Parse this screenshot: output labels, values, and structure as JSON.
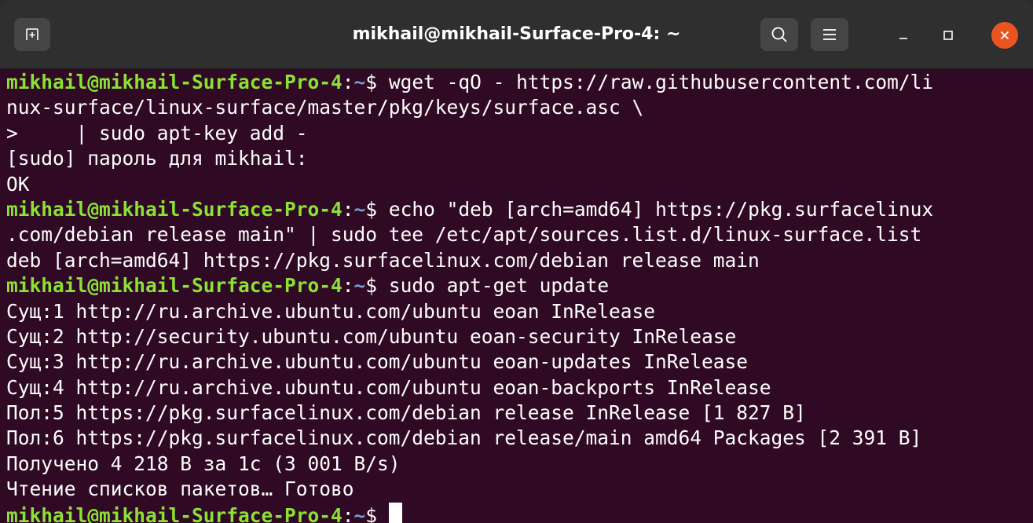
{
  "window": {
    "title": "mikhail@mikhail-Surface-Pro-4: ~"
  },
  "titlebar": {
    "new_tab_icon": "new-tab-icon",
    "search_icon": "search-icon",
    "menu_icon": "hamburger-menu-icon",
    "minimize_icon": "minimize-icon",
    "maximize_icon": "maximize-icon",
    "close_icon": "close-icon",
    "close_color": "#e95420"
  },
  "colors": {
    "background": "#300a24",
    "prompt_user": "#8ae234",
    "prompt_path": "#729fcf",
    "text": "#ffffff"
  },
  "terminal": {
    "prompt": {
      "user": "mikhail@mikhail-Surface-Pro-4",
      "sep": ":",
      "path": "~",
      "dollar": "$ "
    },
    "lines": [
      {
        "prompt": true,
        "text": "wget -qO - https://raw.githubusercontent.com/li"
      },
      {
        "prompt": false,
        "text": "nux-surface/linux-surface/master/pkg/keys/surface.asc \\"
      },
      {
        "prompt": false,
        "text": ">     | sudo apt-key add -"
      },
      {
        "prompt": false,
        "text": "[sudo] пароль для mikhail:"
      },
      {
        "prompt": false,
        "text": "OK"
      },
      {
        "prompt": true,
        "text": "echo \"deb [arch=amd64] https://pkg.surfacelinux"
      },
      {
        "prompt": false,
        "text": ".com/debian release main\" | sudo tee /etc/apt/sources.list.d/linux-surface.list"
      },
      {
        "prompt": false,
        "text": "deb [arch=amd64] https://pkg.surfacelinux.com/debian release main"
      },
      {
        "prompt": true,
        "text": "sudo apt-get update"
      },
      {
        "prompt": false,
        "text": "Сущ:1 http://ru.archive.ubuntu.com/ubuntu eoan InRelease"
      },
      {
        "prompt": false,
        "text": "Сущ:2 http://security.ubuntu.com/ubuntu eoan-security InRelease"
      },
      {
        "prompt": false,
        "text": "Сущ:3 http://ru.archive.ubuntu.com/ubuntu eoan-updates InRelease"
      },
      {
        "prompt": false,
        "text": "Сущ:4 http://ru.archive.ubuntu.com/ubuntu eoan-backports InRelease"
      },
      {
        "prompt": false,
        "text": "Пол:5 https://pkg.surfacelinux.com/debian release InRelease [1 827 B]"
      },
      {
        "prompt": false,
        "text": "Пол:6 https://pkg.surfacelinux.com/debian release/main amd64 Packages [2 391 B]"
      },
      {
        "prompt": false,
        "text": "Получено 4 218 B за 1c (3 001 B/s)"
      },
      {
        "prompt": false,
        "text": "Чтение списков пакетов… Готово"
      },
      {
        "prompt": true,
        "text": "",
        "cursor": true
      }
    ]
  }
}
